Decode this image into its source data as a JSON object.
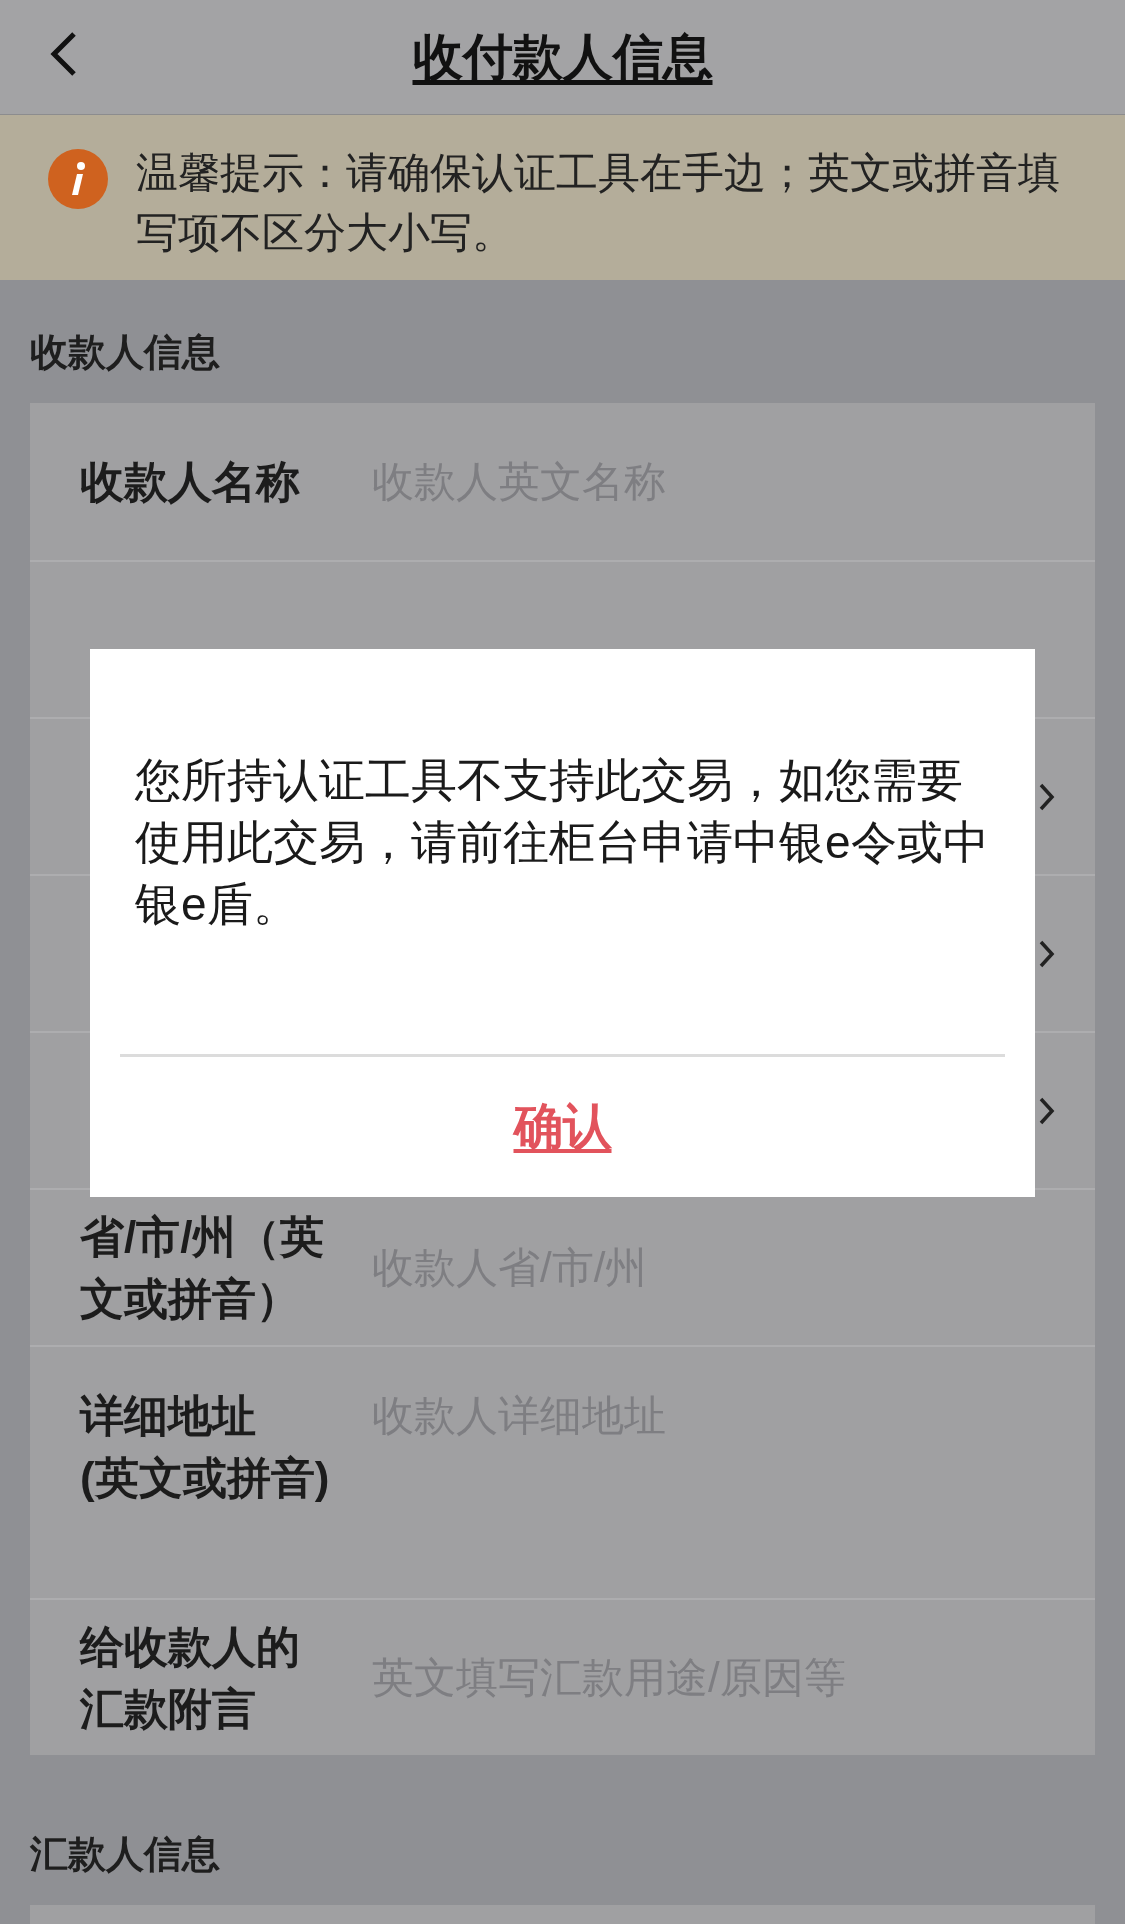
{
  "header": {
    "title": "收付款人信息"
  },
  "notice": {
    "text": "温馨提示：请确保认证工具在手边；英文或拼音填写项不区分大小写。"
  },
  "sections": [
    {
      "title": "收款人信息",
      "rows": [
        {
          "kind": "input",
          "label": "收款人名称",
          "placeholder": "收款人英文名称"
        },
        {
          "kind": "blank"
        },
        {
          "kind": "select"
        },
        {
          "kind": "select"
        },
        {
          "kind": "select"
        },
        {
          "kind": "input",
          "label": "省/市/州（英文或拼音）",
          "placeholder": "收款人省/市/州"
        },
        {
          "kind": "textarea",
          "label": "详细地址\n(英文或拼音)",
          "placeholder": "收款人详细地址"
        },
        {
          "kind": "input",
          "label": "给收款人的汇款附言",
          "placeholder": "英文填写汇款用途/原因等"
        }
      ]
    },
    {
      "title": "汇款人信息"
    }
  ],
  "dialog": {
    "message": "您所持认证工具不支持此交易，如您需要使用此交易，请前往柜台申请中银e令或中银e盾。",
    "confirm": "确认"
  }
}
